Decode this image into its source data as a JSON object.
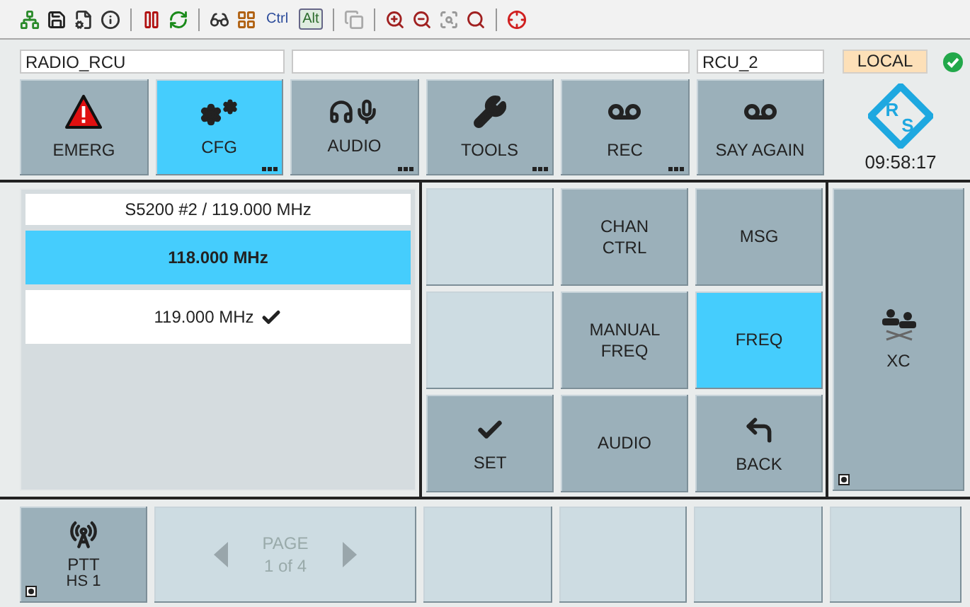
{
  "toolbar": {
    "modifier_keys": [
      {
        "label": "Ctrl",
        "pressed": false
      },
      {
        "label": "Alt",
        "pressed": true
      }
    ]
  },
  "header": {
    "left_field": "RADIO_RCU",
    "right_field": "RCU_2",
    "mode_badge": "LOCAL",
    "status_ok": true
  },
  "function_buttons": [
    {
      "label": "EMERG",
      "kind": "emergency",
      "selected": false,
      "more": false
    },
    {
      "label": "CFG",
      "kind": "config",
      "selected": true,
      "more": true
    },
    {
      "label": "AUDIO",
      "kind": "audio",
      "selected": false,
      "more": true
    },
    {
      "label": "TOOLS",
      "kind": "tools",
      "selected": false,
      "more": true
    },
    {
      "label": "REC",
      "kind": "recorder",
      "selected": false,
      "more": true
    },
    {
      "label": "SAY AGAIN",
      "kind": "recorder",
      "selected": false,
      "more": false
    }
  ],
  "logo": {
    "letters": [
      "R",
      "S"
    ]
  },
  "clock": "09:58:17",
  "channel_list": {
    "header": "S5200 #2 / 119.000 MHz",
    "items": [
      {
        "label": "118.000 MHz",
        "selected": true,
        "checked": false
      },
      {
        "label": "119.000 MHz",
        "selected": false,
        "checked": true
      }
    ]
  },
  "grid": [
    {
      "kind": "blank"
    },
    {
      "kind": "text",
      "label": "CHAN CTRL",
      "selected": false
    },
    {
      "kind": "text",
      "label": "MSG",
      "selected": false
    },
    {
      "kind": "blank"
    },
    {
      "kind": "text",
      "label": "MANUAL FREQ",
      "selected": false
    },
    {
      "kind": "text",
      "label": "FREQ",
      "selected": true
    },
    {
      "kind": "set",
      "label": "SET",
      "selected": false
    },
    {
      "kind": "text",
      "label": "AUDIO",
      "selected": false
    },
    {
      "kind": "back",
      "label": "BACK",
      "selected": false
    }
  ],
  "crossconnect": {
    "label": "XC",
    "marker": true
  },
  "bottom": {
    "ptt": {
      "label": "PTT",
      "sublabel": "HS 1",
      "marker": true
    },
    "pager": {
      "title": "PAGE",
      "count": "1 of 4",
      "disabled": true
    },
    "slots": [
      {
        "kind": "blank"
      },
      {
        "kind": "blank"
      },
      {
        "kind": "blank"
      },
      {
        "kind": "blank"
      }
    ]
  }
}
